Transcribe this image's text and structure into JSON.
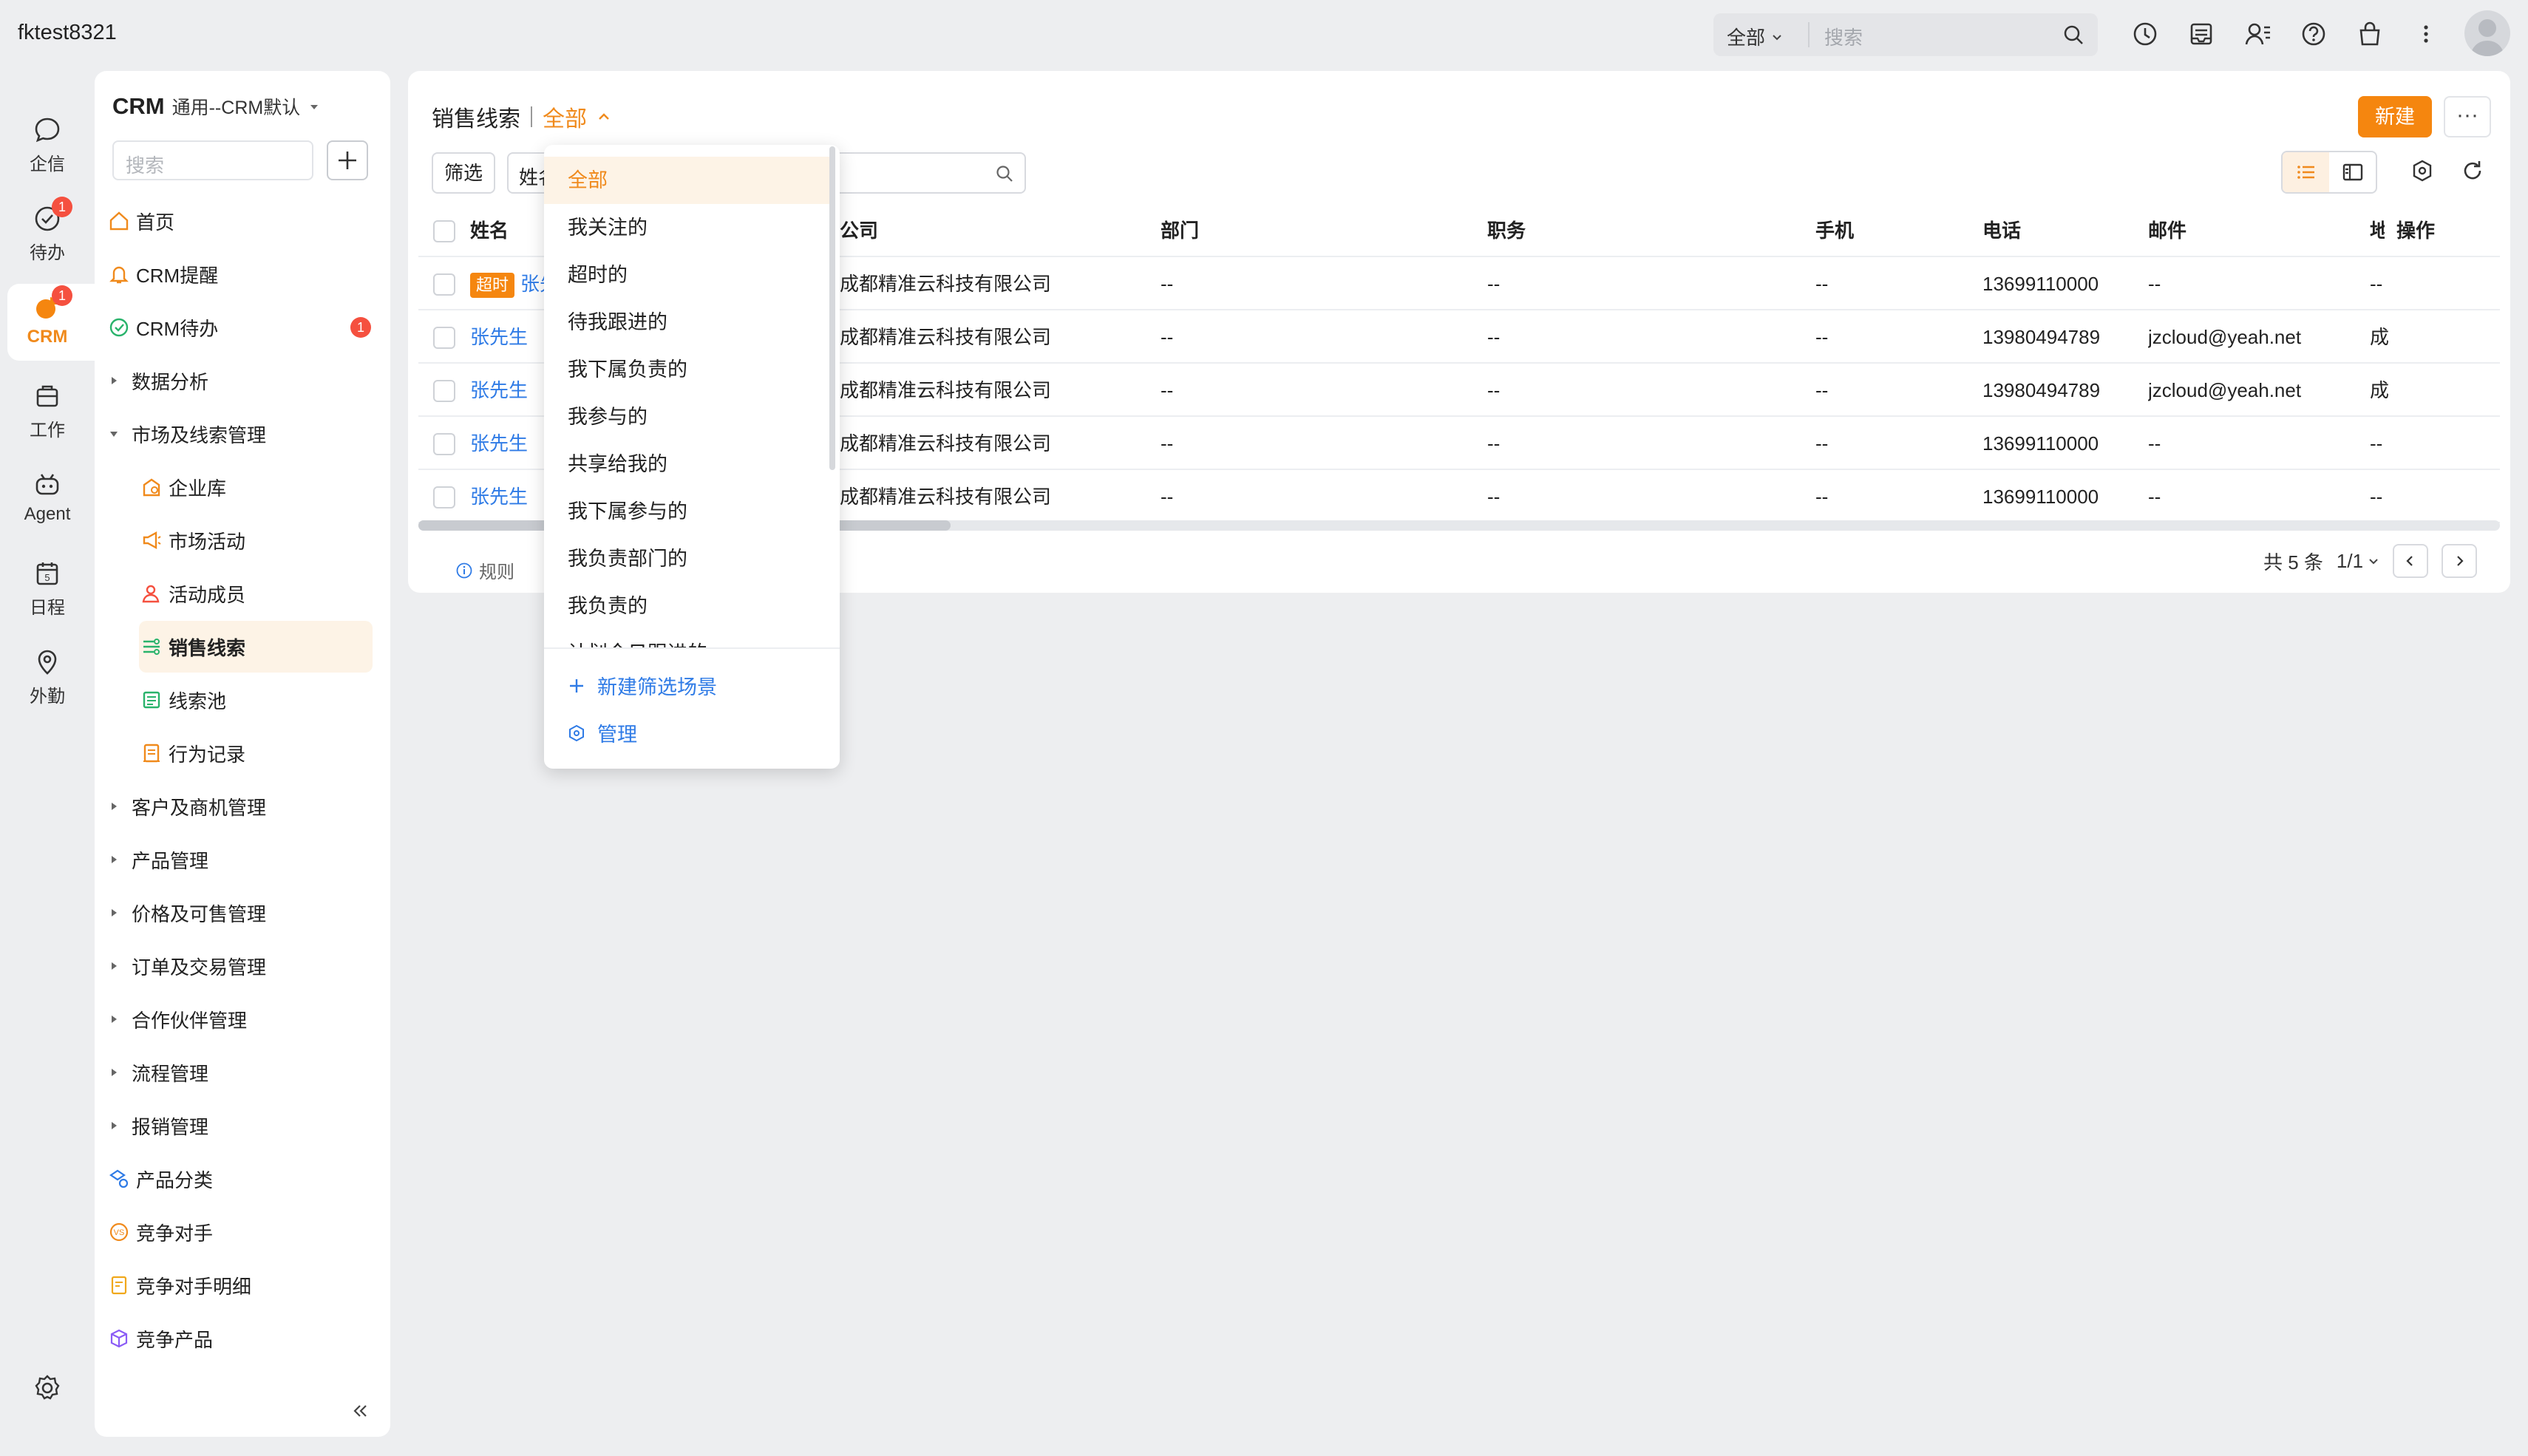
{
  "topbar": {
    "username": "fktest8321",
    "search_scope": "全部",
    "search_placeholder": "搜索"
  },
  "rail": {
    "items": [
      {
        "label": "企信",
        "icon": "chat-icon"
      },
      {
        "label": "待办",
        "icon": "todo-check-icon",
        "badge": "1"
      },
      {
        "label": "CRM",
        "icon": "crm-icon",
        "badge": "1"
      },
      {
        "label": "工作",
        "icon": "briefcase-icon"
      },
      {
        "label": "Agent",
        "icon": "robot-icon"
      },
      {
        "label": "日程",
        "icon": "calendar-icon",
        "day": "5"
      },
      {
        "label": "外勤",
        "icon": "location-pin-icon"
      }
    ]
  },
  "nav": {
    "title": "CRM",
    "subtitle": "通用--CRM默认",
    "search_placeholder": "搜索",
    "badge_crm_todo": "1",
    "items": [
      {
        "label": "首页"
      },
      {
        "label": "CRM提醒"
      },
      {
        "label": "CRM待办"
      },
      {
        "label": "数据分析"
      },
      {
        "label": "市场及线索管理"
      },
      {
        "label": "企业库"
      },
      {
        "label": "市场活动"
      },
      {
        "label": "活动成员"
      },
      {
        "label": "销售线索"
      },
      {
        "label": "线索池"
      },
      {
        "label": "行为记录"
      },
      {
        "label": "客户及商机管理"
      },
      {
        "label": "产品管理"
      },
      {
        "label": "价格及可售管理"
      },
      {
        "label": "订单及交易管理"
      },
      {
        "label": "合作伙伴管理"
      },
      {
        "label": "流程管理"
      },
      {
        "label": "报销管理"
      },
      {
        "label": "产品分类"
      },
      {
        "label": "竞争对手"
      },
      {
        "label": "竞争对手明细"
      },
      {
        "label": "竞争产品"
      }
    ]
  },
  "main": {
    "title": "销售线索",
    "scene": "全部",
    "new_button": "新建",
    "more_button": "···",
    "filter_button": "筛选",
    "field_select": "姓名",
    "columns": [
      "姓名",
      "公司",
      "部门",
      "职务",
      "手机",
      "电话",
      "邮件",
      "地",
      "操作"
    ],
    "overdue_tag": "超时",
    "rows": [
      {
        "name": "张先生",
        "company": "成都精准云科技有限公司",
        "dept": "--",
        "title": "--",
        "mobile": "--",
        "phone": "13699110000",
        "email": "--",
        "addr": "--",
        "overdue": true
      },
      {
        "name": "张先生",
        "company": "成都精准云科技有限公司",
        "dept": "--",
        "title": "--",
        "mobile": "--",
        "phone": "13980494789",
        "email": "jzcloud@yeah.net",
        "addr": "成"
      },
      {
        "name": "张先生",
        "company": "成都精准云科技有限公司",
        "dept": "--",
        "title": "--",
        "mobile": "--",
        "phone": "13980494789",
        "email": "jzcloud@yeah.net",
        "addr": "成"
      },
      {
        "name": "张先生",
        "company": "成都精准云科技有限公司",
        "dept": "--",
        "title": "--",
        "mobile": "--",
        "phone": "13699110000",
        "email": "--",
        "addr": "--"
      },
      {
        "name": "张先生",
        "company": "成都精准云科技有限公司",
        "dept": "--",
        "title": "--",
        "mobile": "--",
        "phone": "13699110000",
        "email": "--",
        "addr": "--"
      }
    ],
    "rules_label": "规则",
    "total_text": "共 5 条",
    "page_text": "1/1"
  },
  "scene_dropdown": {
    "options": [
      "全部",
      "我关注的",
      "超时的",
      "待我跟进的",
      "我下属负责的",
      "我参与的",
      "共享给我的",
      "我下属参与的",
      "我负责部门的",
      "我负责的",
      "计划今日跟进的"
    ],
    "selected": "全部",
    "new_scene": "新建筛选场景",
    "manage": "管理"
  },
  "colors": {
    "accent": "#f5860f",
    "link": "#2f7be6",
    "badge": "#f5503f",
    "active_bg": "#fdf3e6"
  }
}
